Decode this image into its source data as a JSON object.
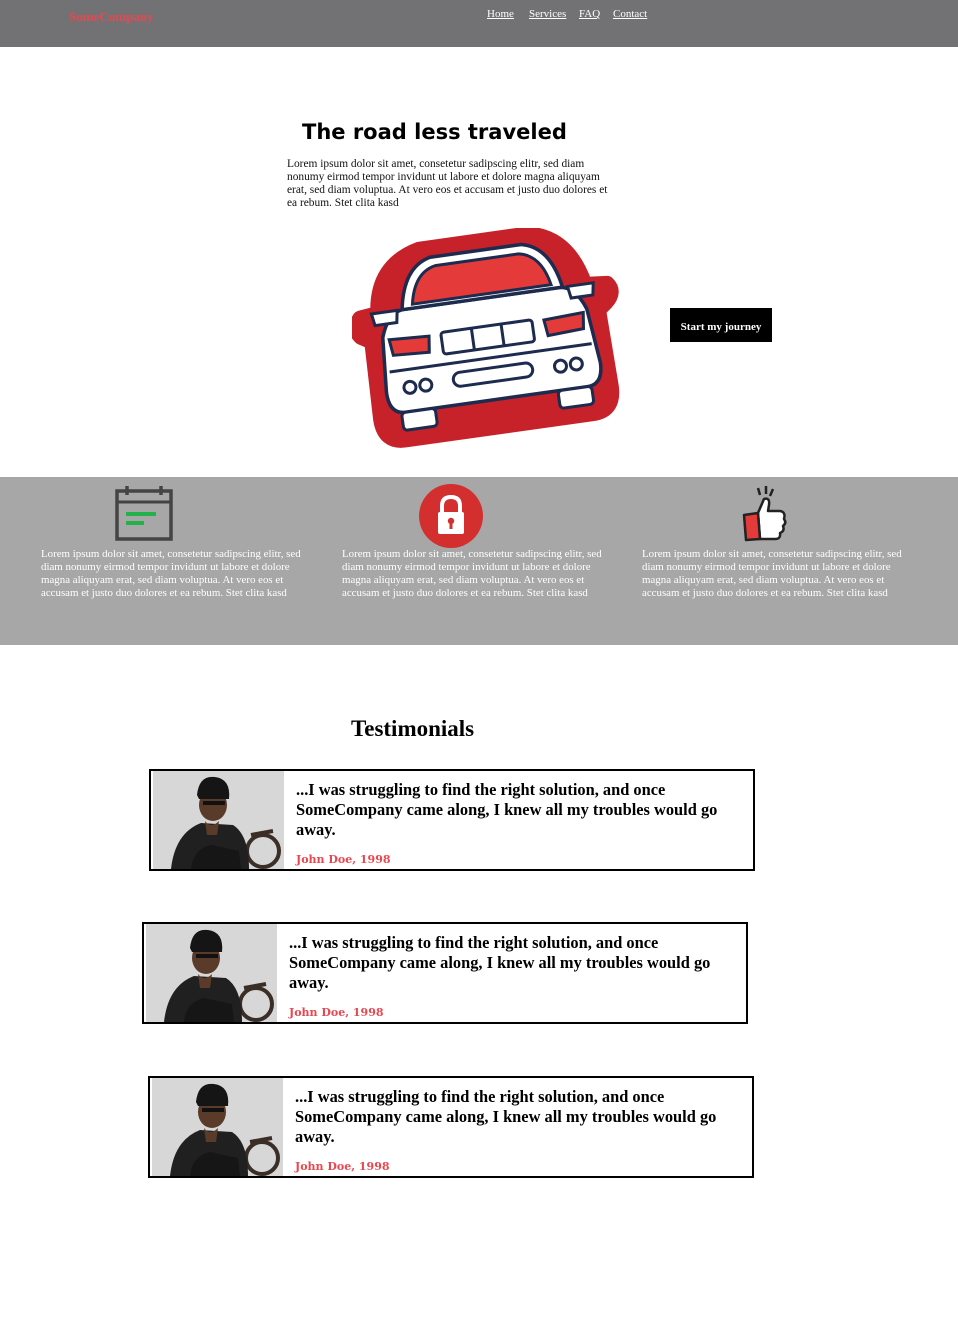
{
  "header": {
    "brand": "SomeCompany",
    "nav": [
      {
        "label": "Home"
      },
      {
        "label": "Services"
      },
      {
        "label": "FAQ"
      },
      {
        "label": "Contact"
      }
    ]
  },
  "hero": {
    "title": "The road less traveled",
    "text": "Lorem ipsum dolor sit amet, consetetur sadipscing elitr, sed diam nonumy eirmod tempor invidunt ut labore et dolore magna aliquyam erat, sed diam voluptua. At vero eos et accusam et justo duo dolores et ea rebum. Stet clita kasd",
    "cta_label": "Start my journey",
    "image_icon": "car-icon"
  },
  "features": [
    {
      "icon": "calendar-icon",
      "text": "Lorem ipsum dolor sit amet, consetetur sadipscing elitr, sed diam nonumy eirmod tempor invidunt ut labore et dolore magna aliquyam erat, sed diam voluptua. At vero eos et accusam et justo duo dolores et ea rebum. Stet clita kasd"
    },
    {
      "icon": "lock-icon",
      "text": "Lorem ipsum dolor sit amet, consetetur sadipscing elitr, sed diam nonumy eirmod tempor invidunt ut labore et dolore magna aliquyam erat, sed diam voluptua. At vero eos et accusam et justo duo dolores et ea rebum. Stet clita kasd"
    },
    {
      "icon": "thumbs-up-icon",
      "text": "Lorem ipsum dolor sit amet, consetetur sadipscing elitr, sed diam nonumy eirmod tempor invidunt ut labore et dolore magna aliquyam erat, sed diam voluptua. At vero eos et accusam et justo duo dolores et ea rebum. Stet clita kasd"
    }
  ],
  "testimonials": {
    "heading": "Testimonials",
    "items": [
      {
        "quote": "...I was struggling to find the right solution, and once SomeCompany came along, I knew all my troubles would go away.",
        "author": "John Doe, 1998"
      },
      {
        "quote": "...I was struggling to find the right solution, and once SomeCompany came along, I knew all my troubles would go away.",
        "author": "John Doe, 1998"
      },
      {
        "quote": "...I was struggling to find the right solution, and once SomeCompany came along, I knew all my troubles would go away.",
        "author": "John Doe, 1998"
      }
    ]
  },
  "colors": {
    "header_bg": "#727274",
    "brand": "#e8474f",
    "band_bg": "#a7a7a8",
    "accent_red": "#e53a3a",
    "author": "#e8474f",
    "cta_bg": "#000000"
  }
}
